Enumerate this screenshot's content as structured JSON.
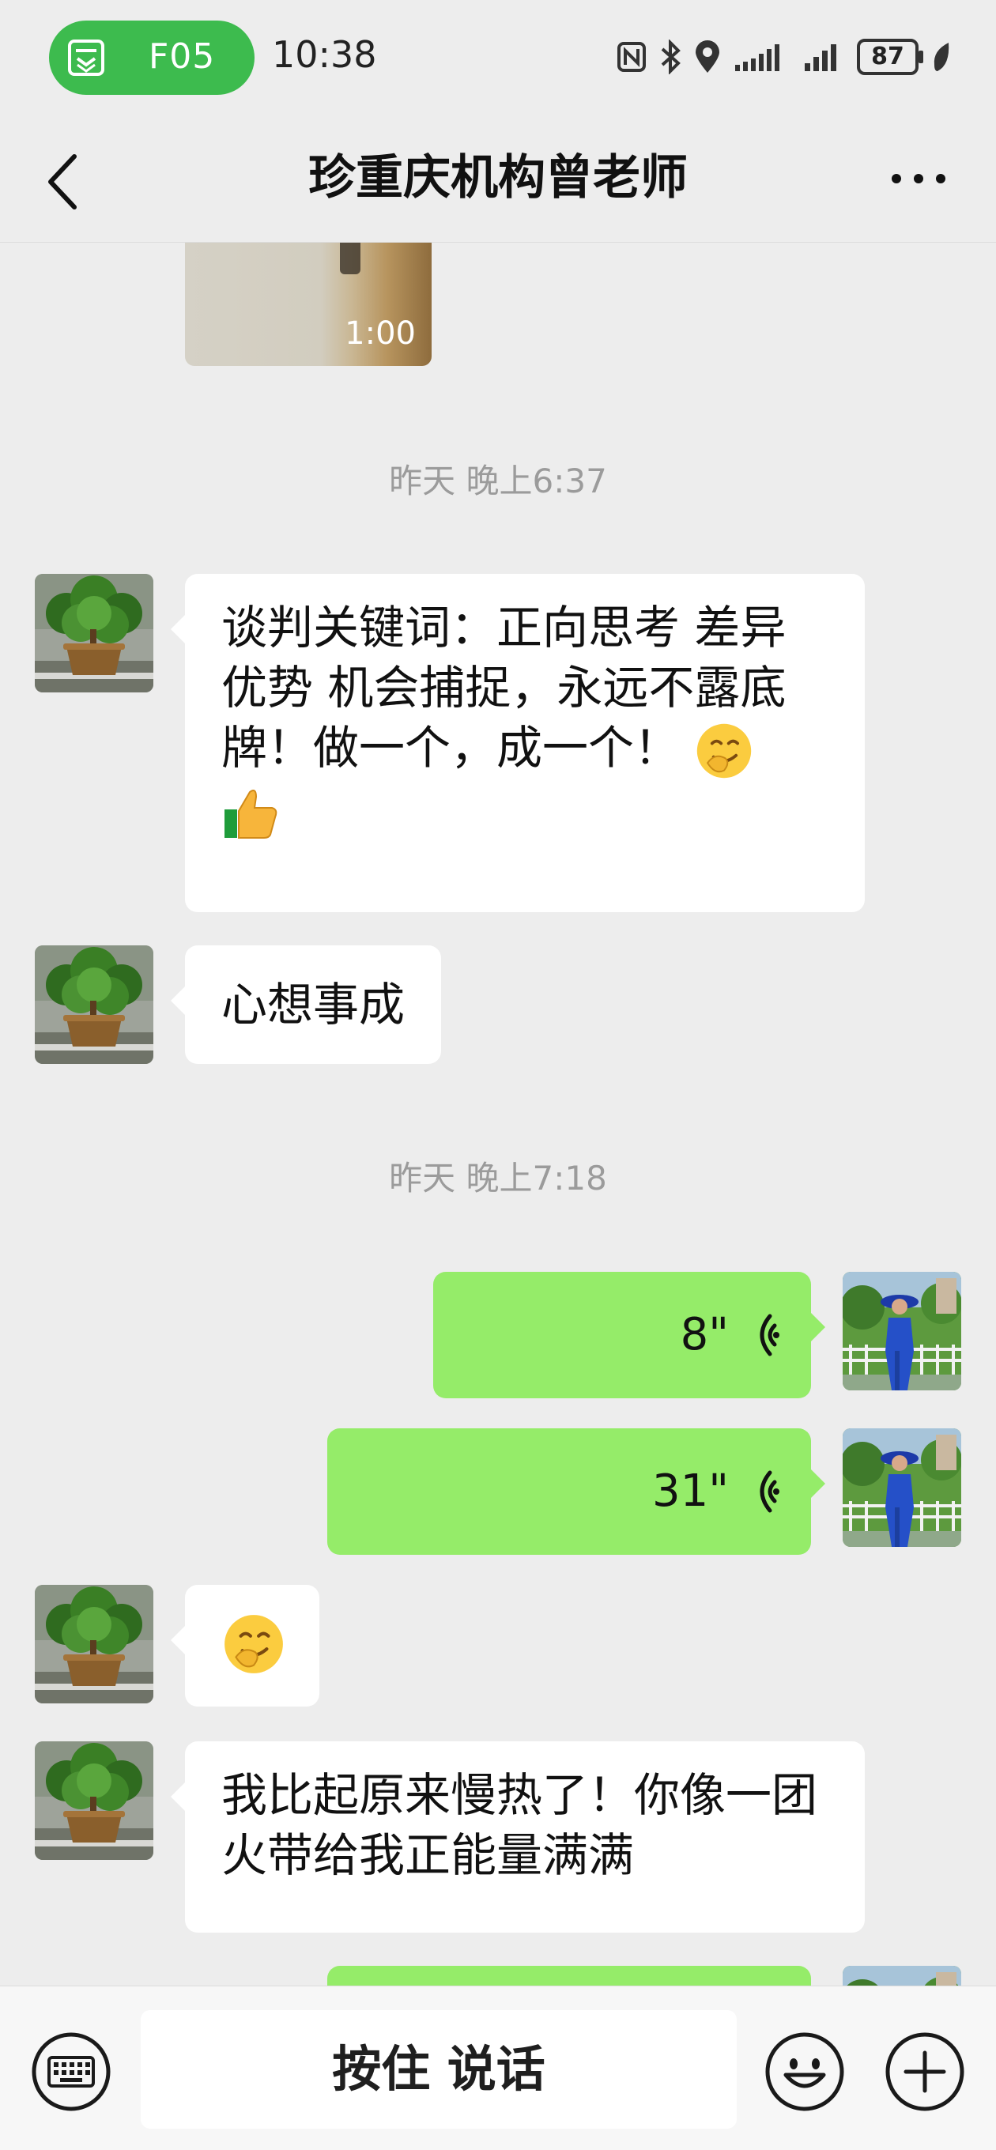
{
  "status_bar": {
    "pill_label": "F05",
    "time": "10:38",
    "battery": "87"
  },
  "header": {
    "title": "珍重庆机构曾老师"
  },
  "messages": {
    "video_duration": "1:00",
    "timestamp_1": "昨天 晚上6:37",
    "msg_1_text": "谈判关键词：正向思考 差异优势 机会捕捉，永远不露底牌！做一个，成一个！",
    "msg_2_text": "心想事成",
    "timestamp_2": "昨天 晚上7:18",
    "voice_1_duration": "8\"",
    "voice_2_duration": "31\"",
    "msg_4_text": "我比起原来慢热了！你像一团火带给我正能量满满"
  },
  "input_bar": {
    "talk_button_label": "按住 说话"
  },
  "colors": {
    "background": "#ededed",
    "incoming_bubble": "#ffffff",
    "outgoing_bubble": "#95ec69",
    "status_pill": "#3dbb4e"
  },
  "icons": [
    "back-icon",
    "more-icon",
    "keyboard-icon",
    "emoji-icon",
    "plus-icon",
    "voice-wave-icon",
    "nfc-icon",
    "bluetooth-icon",
    "location-icon",
    "signal-icon"
  ]
}
